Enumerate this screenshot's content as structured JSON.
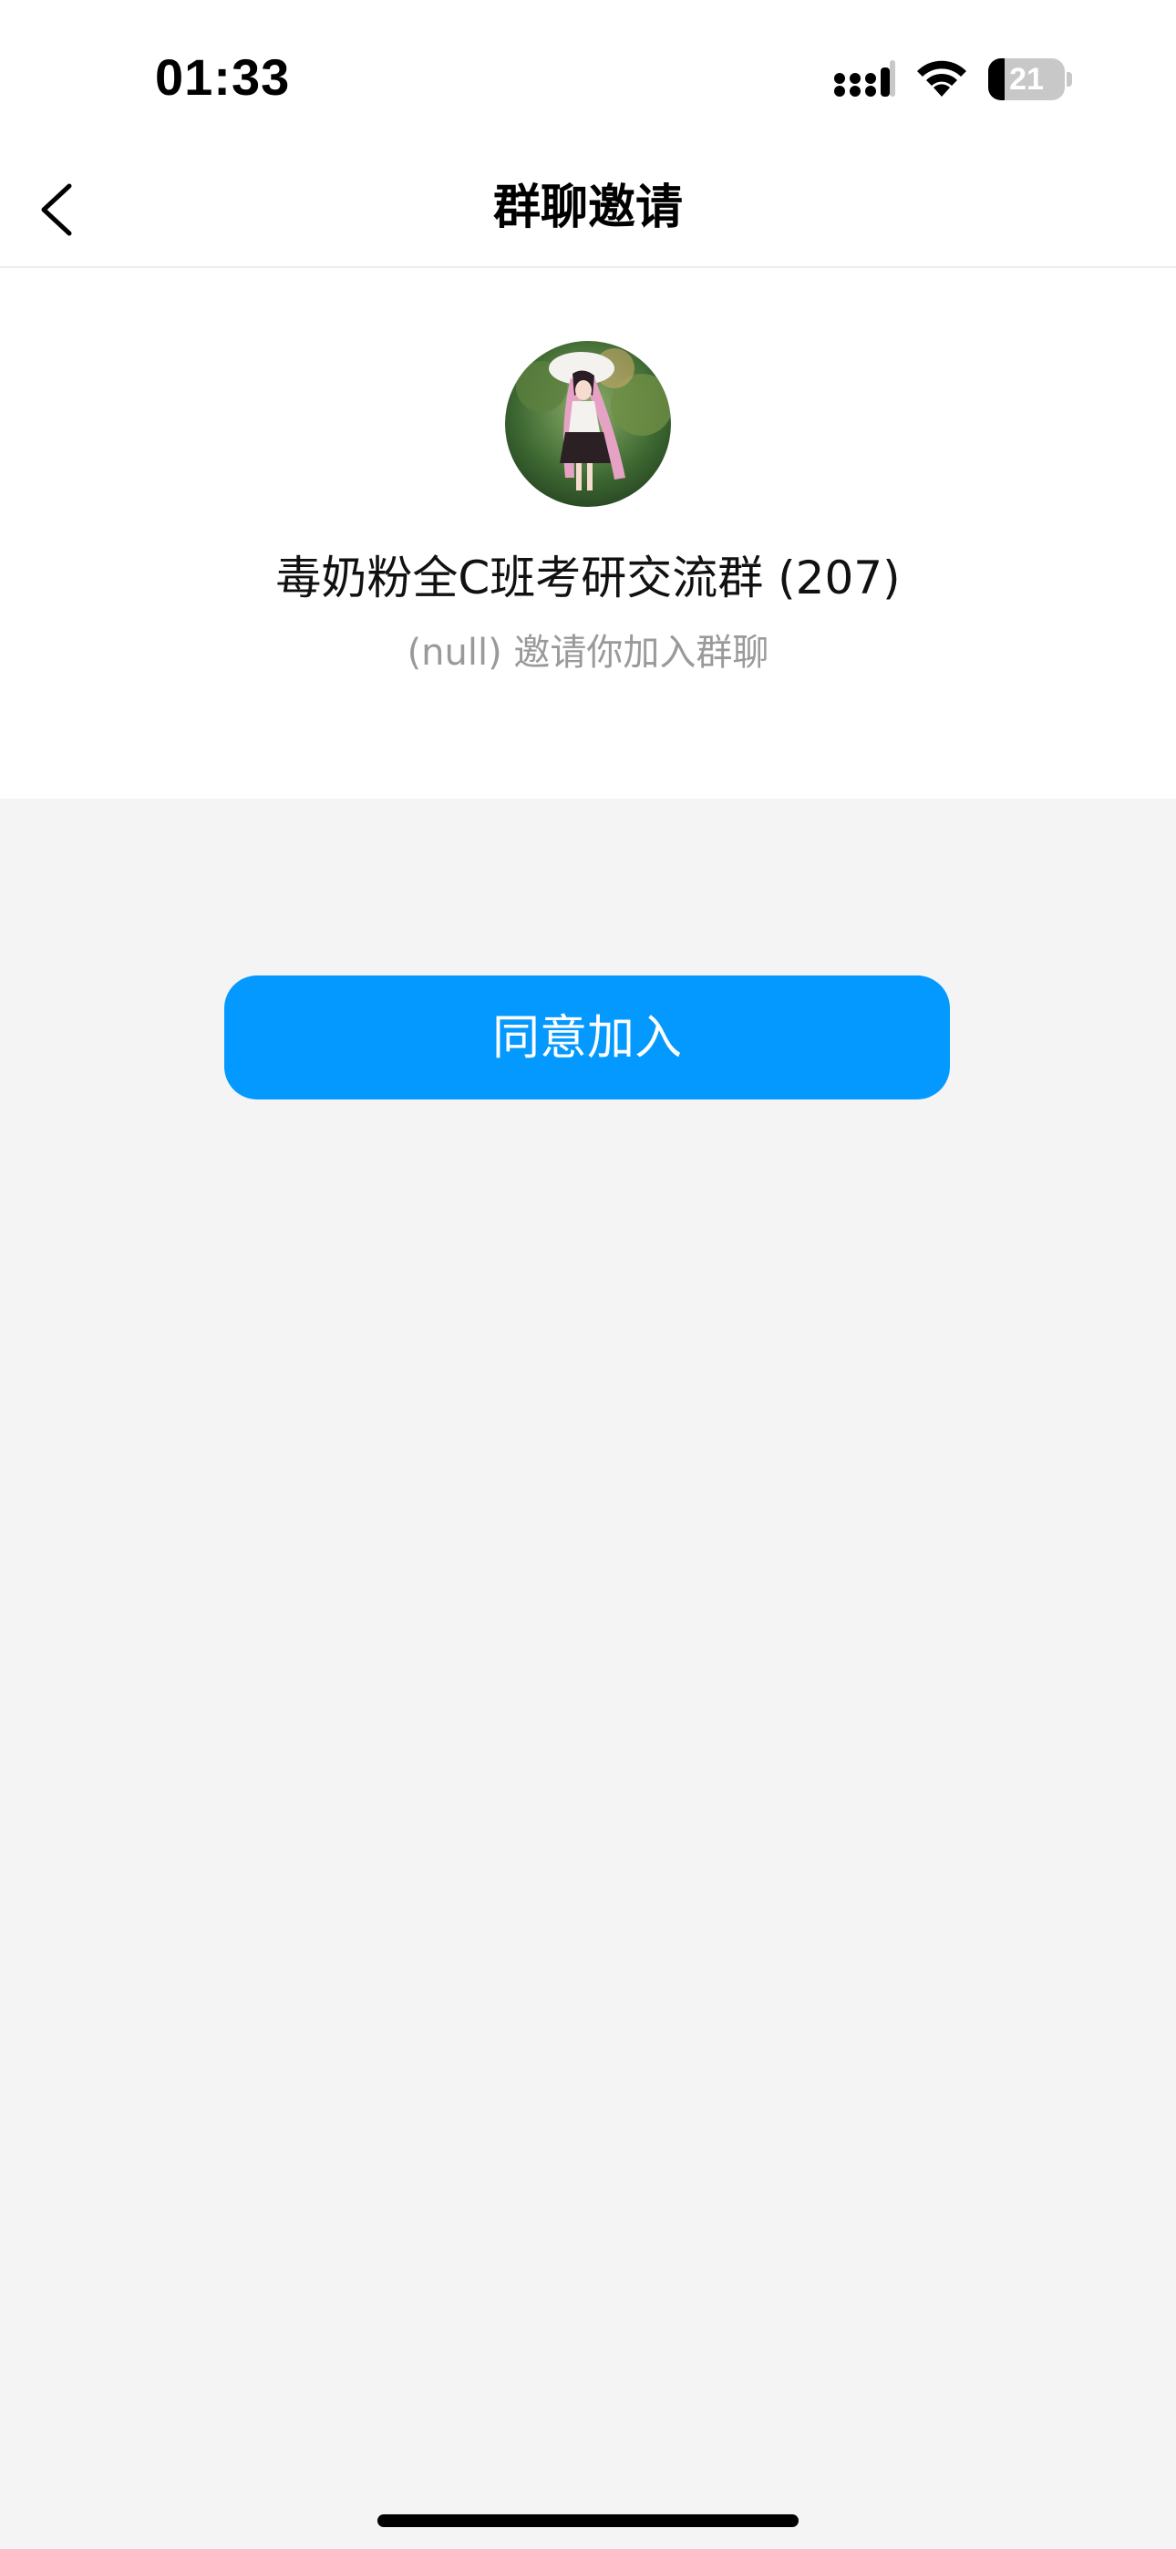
{
  "status_bar": {
    "time": "01:33",
    "battery_level": "21",
    "battery_fraction": 0.21,
    "icons": [
      "signal-icon",
      "wifi-icon",
      "battery-icon"
    ]
  },
  "nav": {
    "title": "群聊邀请",
    "back_icon": "chevron-left-icon"
  },
  "group": {
    "name": "毒奶粉全C班考研交流群 (207)",
    "invite_text": "(null) 邀请你加入群聊",
    "avatar": "group-avatar-image"
  },
  "actions": {
    "join_label": "同意加入"
  },
  "colors": {
    "primary": "#0399fe",
    "background": "#f4f4f4",
    "card": "#ffffff",
    "muted_text": "#9a9a9a"
  }
}
